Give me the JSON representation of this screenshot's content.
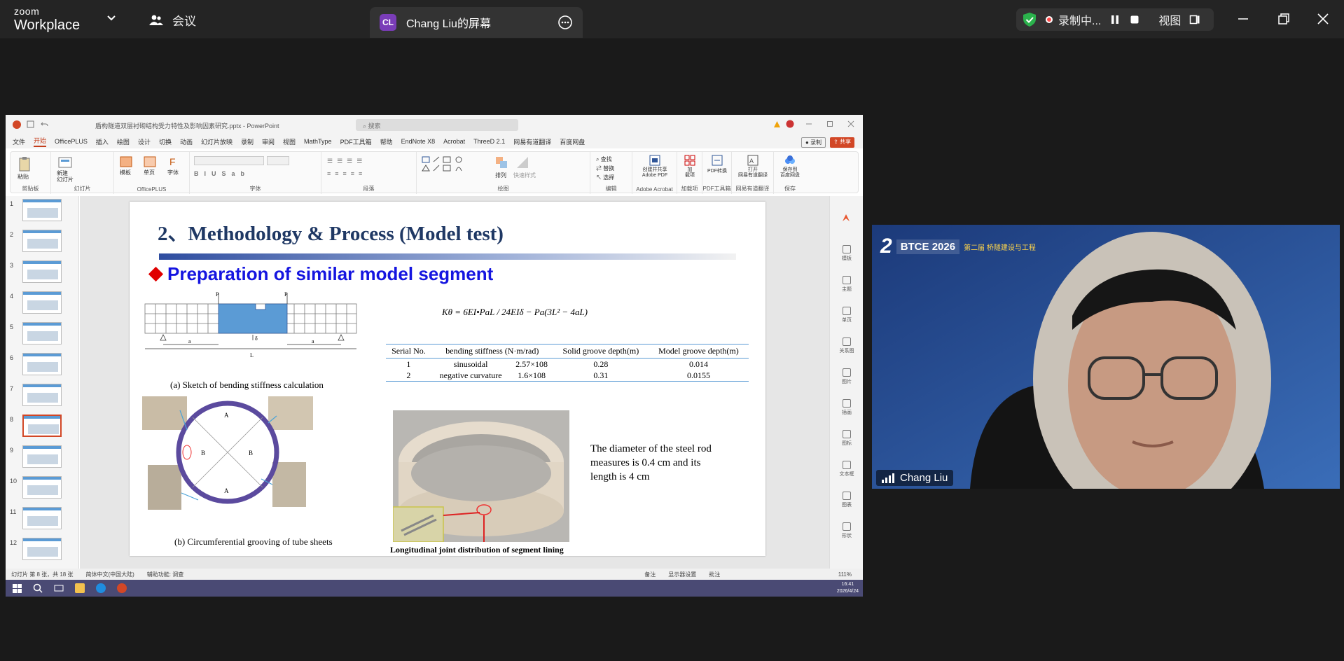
{
  "zoom": {
    "brand_top": "zoom",
    "brand_bottom": "Workplace",
    "meeting_label": "会议",
    "share_tab": {
      "initials": "CL",
      "title": "Chang Liu的屏幕"
    },
    "recording": {
      "label": "录制中...",
      "view_label": "视图"
    }
  },
  "powerpoint": {
    "file_name": "盾构隧道双层衬砌结构受力特性及影响因素研究.pptx - PowerPoint",
    "search_placeholder": "搜索",
    "tabs": [
      "文件",
      "开始",
      "OfficePLUS",
      "插入",
      "绘图",
      "设计",
      "切换",
      "动画",
      "幻灯片放映",
      "录制",
      "审阅",
      "视图",
      "MathType",
      "PDF工具箱",
      "帮助",
      "EndNote X8",
      "Acrobat",
      "ThreeD 2.1",
      "网易有道翻译",
      "百度网盘"
    ],
    "active_tab": "开始",
    "record_btn": "录制",
    "share_btn": "共享",
    "ribbon_groups": [
      "剪贴板",
      "幻灯片",
      "OfficePLUS",
      "字体",
      "段落",
      "绘图",
      "编辑",
      "Adobe Acrobat",
      "加载项",
      "PDF工具箱",
      "网易有道翻译",
      "保存"
    ],
    "ribbon_buttons": {
      "paste": "粘贴",
      "new_slide": "新建\n幻灯片",
      "template": "模板",
      "single_page": "单页",
      "font": "字体",
      "find": "查找",
      "replace": "替换",
      "select": "选择",
      "arrange": "排列",
      "quick_styles": "快速样式",
      "create_pdf": "创建并共享\nAdobe PDF",
      "addins": "加\n载项",
      "pdf_convert": "PDF转换",
      "open_youdao": "打开\n网易有道翻译",
      "save_baidu": "保存到\n百度网盘"
    },
    "right_pane": [
      "模板",
      "主题",
      "单页",
      "关系图",
      "图片",
      "插画",
      "图标",
      "文本框",
      "图表",
      "形状"
    ],
    "status": {
      "slide_info": "幻灯片 第 8 张，共 18 张",
      "language": "简体中文(中国大陆)",
      "accessibility": "辅助功能: 调查",
      "notes": "备注",
      "display": "显示器设置",
      "comments": "批注",
      "zoom": "111%"
    },
    "clock": {
      "time": "16:41",
      "date": "2026/4/24"
    }
  },
  "slide": {
    "title": "2、Methodology & Process (Model test)",
    "subtitle": "Preparation of similar model segment",
    "formula": "Kθ = 6EI•PaL / 24EIδ − Pa(3L² − 4aL)",
    "cap_a": "(a) Sketch of bending stiffness calculation",
    "cap_b": "(b) Circumferential grooving of tube sheets",
    "cap_photo": "Longitudinal joint distribution of segment lining",
    "note": "The diameter of the steel rod measures is 0.4 cm and its length is 4 cm",
    "sketch_labels": {
      "p": "P",
      "a": "a",
      "l": "L",
      "d": "δ"
    },
    "ring_labels": {
      "a": "A",
      "b": "B"
    },
    "table": {
      "headers": [
        "Serial No.",
        "bending stiffness (N·m/rad)",
        "Solid groove depth(m)",
        "Model groove depth(m)"
      ],
      "rows": [
        [
          "1",
          "sinusoidal",
          "2.57×108",
          "0.28",
          "0.014"
        ],
        [
          "2",
          "negative curvature",
          "1.6×108",
          "0.31",
          "0.0155"
        ]
      ]
    }
  },
  "video": {
    "name": "Chang Liu",
    "banner_num": "2",
    "banner_brand": "BTCE 2026",
    "banner_cn": "第二届 桥隧建设与工程"
  },
  "thumbnails": [
    "1",
    "2",
    "3",
    "4",
    "5",
    "6",
    "7",
    "8",
    "9",
    "10",
    "11",
    "12"
  ],
  "selected_slide": "8"
}
